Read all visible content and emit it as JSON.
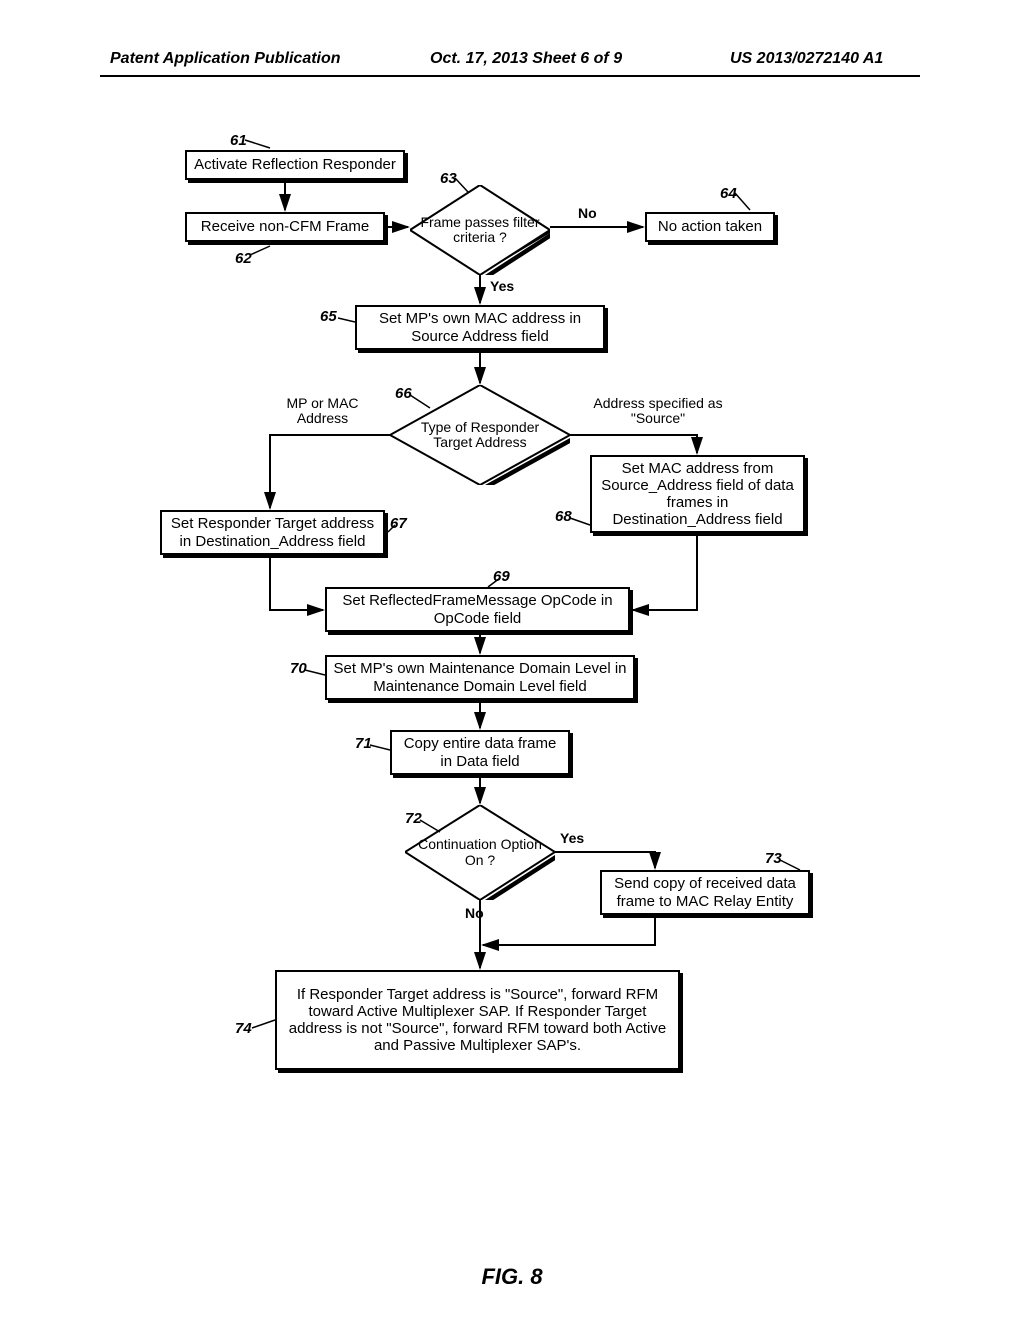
{
  "header": {
    "left": "Patent Application Publication",
    "center": "Oct. 17, 2013  Sheet 6 of 9",
    "right": "US 2013/0272140 A1"
  },
  "nodes": {
    "n61": {
      "ref": "61",
      "text": "Activate Reflection Responder"
    },
    "n62": {
      "ref": "62",
      "text": "Receive non-CFM Frame"
    },
    "n63": {
      "ref": "63",
      "text": "Frame passes filter criteria ?",
      "yes": "Yes",
      "no": "No"
    },
    "n64": {
      "ref": "64",
      "text": "No action taken"
    },
    "n65": {
      "ref": "65",
      "text": "Set MP's own MAC address in Source Address field"
    },
    "n66": {
      "ref": "66",
      "text": "Type of Responder Target Address",
      "left": "MP or MAC Address",
      "right": "Address specified as \"Source\""
    },
    "n67": {
      "ref": "67",
      "text": "Set Responder Target address in Destination_Address field"
    },
    "n68": {
      "ref": "68",
      "text": "Set MAC address from Source_Address field of data frames in Destination_Address field"
    },
    "n69": {
      "ref": "69",
      "text": "Set ReflectedFrameMessage OpCode in OpCode field"
    },
    "n70": {
      "ref": "70",
      "text": "Set MP's own Maintenance Domain Level in Maintenance Domain Level field"
    },
    "n71": {
      "ref": "71",
      "text": "Copy entire data frame in Data field"
    },
    "n72": {
      "ref": "72",
      "text": "Continuation Option On ?",
      "yes": "Yes",
      "no": "No"
    },
    "n73": {
      "ref": "73",
      "text": "Send copy of received data frame to MAC Relay Entity"
    },
    "n74": {
      "ref": "74",
      "text": "If Responder Target address is \"Source\", forward RFM toward Active Multiplexer SAP. If Responder Target address is not \"Source\", forward RFM toward both Active and Passive Multiplexer SAP's."
    }
  },
  "figure": "FIG. 8",
  "chart_data": {
    "type": "flowchart",
    "title": "FIG. 8",
    "nodes": [
      {
        "id": 61,
        "type": "process",
        "label": "Activate Reflection Responder"
      },
      {
        "id": 62,
        "type": "process",
        "label": "Receive non-CFM Frame"
      },
      {
        "id": 63,
        "type": "decision",
        "label": "Frame passes filter criteria ?"
      },
      {
        "id": 64,
        "type": "process",
        "label": "No action taken"
      },
      {
        "id": 65,
        "type": "process",
        "label": "Set MP's own MAC address in Source Address field"
      },
      {
        "id": 66,
        "type": "decision",
        "label": "Type of Responder Target Address"
      },
      {
        "id": 67,
        "type": "process",
        "label": "Set Responder Target address in Destination_Address field"
      },
      {
        "id": 68,
        "type": "process",
        "label": "Set MAC address from Source_Address field of data frames in Destination_Address field"
      },
      {
        "id": 69,
        "type": "process",
        "label": "Set ReflectedFrameMessage OpCode in OpCode field"
      },
      {
        "id": 70,
        "type": "process",
        "label": "Set MP's own Maintenance Domain Level in Maintenance Domain Level field"
      },
      {
        "id": 71,
        "type": "process",
        "label": "Copy entire data frame in Data field"
      },
      {
        "id": 72,
        "type": "decision",
        "label": "Continuation Option On ?"
      },
      {
        "id": 73,
        "type": "process",
        "label": "Send copy of received data frame to MAC Relay Entity"
      },
      {
        "id": 74,
        "type": "process",
        "label": "If Responder Target address is \"Source\", forward RFM toward Active Multiplexer SAP. If Responder Target address is not \"Source\", forward RFM toward both Active and Passive Multiplexer SAP's."
      }
    ],
    "edges": [
      {
        "from": 61,
        "to": 62
      },
      {
        "from": 62,
        "to": 63
      },
      {
        "from": 63,
        "to": 64,
        "label": "No"
      },
      {
        "from": 63,
        "to": 65,
        "label": "Yes"
      },
      {
        "from": 65,
        "to": 66
      },
      {
        "from": 66,
        "to": 67,
        "label": "MP or MAC Address"
      },
      {
        "from": 66,
        "to": 68,
        "label": "Address specified as \"Source\""
      },
      {
        "from": 67,
        "to": 69
      },
      {
        "from": 68,
        "to": 69
      },
      {
        "from": 69,
        "to": 70
      },
      {
        "from": 70,
        "to": 71
      },
      {
        "from": 71,
        "to": 72
      },
      {
        "from": 72,
        "to": 73,
        "label": "Yes"
      },
      {
        "from": 72,
        "to": 74,
        "label": "No"
      },
      {
        "from": 73,
        "to": 74
      }
    ]
  }
}
